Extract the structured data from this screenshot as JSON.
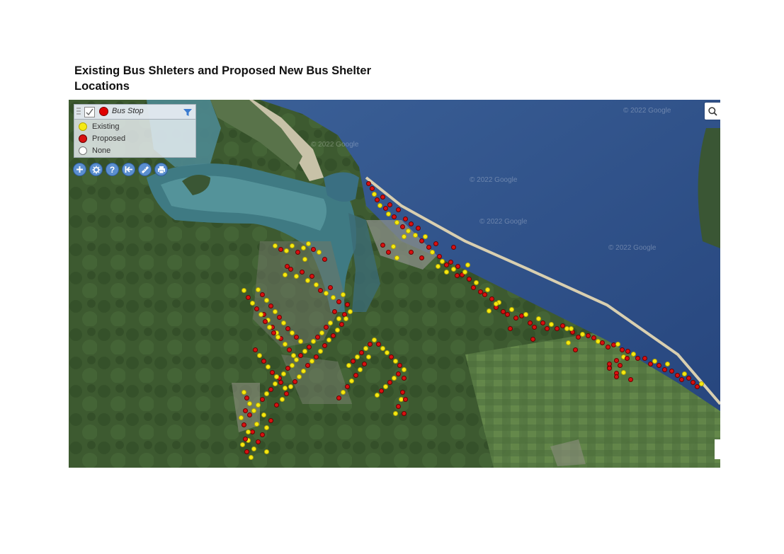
{
  "page": {
    "title_line1": "Existing Bus Shleters and Proposed New Bus Shelter",
    "title_line2": "Locations"
  },
  "map": {
    "watermark": "© 2022 Google",
    "legend": {
      "layer_name": "Bus Stop",
      "items": [
        {
          "label": "Existing",
          "color": "#f5ea12"
        },
        {
          "label": "Proposed",
          "color": "#d81010"
        },
        {
          "label": "None",
          "color": "#ffffff"
        }
      ]
    },
    "tools": [
      "add-icon",
      "settings-icon",
      "help-icon",
      "back-icon",
      "measure-icon",
      "print-icon"
    ],
    "colors": {
      "existing": "#f5ea12",
      "proposed": "#d81010",
      "sea": "#2d4f86",
      "land": "#3e5a32"
    }
  }
}
